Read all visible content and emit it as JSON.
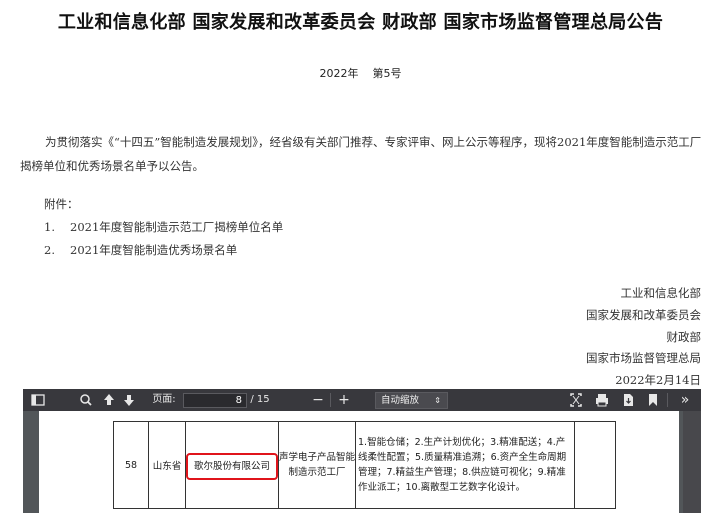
{
  "title": "工业和信息化部 国家发展和改革委员会 财政部 国家市场监督管理总局公告",
  "issue": {
    "year": "2022年",
    "number": "第5号"
  },
  "body": "为贯彻落实《“十四五”智能制造发展规划》，经省级有关部门推荐、专家评审、网上公示等程序，现将2021年度智能制造示范工厂揭榜单位和优秀场景名单予以公告。",
  "attachments": {
    "label": "附件：",
    "items": [
      {
        "num": "1.",
        "text": "2021年度智能制造示范工厂揭榜单位名单"
      },
      {
        "num": "2.",
        "text": "2021年度智能制造优秀场景名单"
      }
    ]
  },
  "signatories": [
    "工业和信息化部",
    "国家发展和改革委员会",
    "财政部",
    "国家市场监督管理总局"
  ],
  "date": "2022年2月14日",
  "viewer": {
    "page_label": "页面:",
    "current_page": "8",
    "total_pages": "/ 15",
    "zoom": "自动缩放",
    "zoom_arrow": "⇕",
    "zoom_out": "−",
    "zoom_in": "+",
    "more": "»"
  },
  "table_row": {
    "number": "58",
    "province": "山东省",
    "company": "歌尔股份有限公司",
    "scene": "声学电子产品智能制造示范工厂",
    "description": "1.智能仓储；2.生产计划优化；3.精准配送；4.产线柔性配置；5.质量精准追溯；6.资产全生命周期管理；7.精益生产管理；8.供应链可视化；9.精准作业派工；10.离散型工艺数字化设计。"
  },
  "colors": {
    "highlight": "#e0141b",
    "toolbar": "#38383d",
    "viewer_bg": "#525659"
  }
}
